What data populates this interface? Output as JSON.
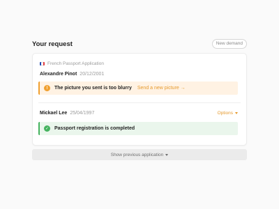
{
  "header": {
    "title": "Your request",
    "new_demand_label": "New demand"
  },
  "application": {
    "label": "French Passport Application",
    "flag_icon": "france-flag-icon",
    "flag_colors": [
      "#1f49b3",
      "#ffffff",
      "#e03a3e"
    ]
  },
  "requests": [
    {
      "name": "Alexandre Pinot",
      "date": "20/12/2001",
      "alert": {
        "status": "warning",
        "icon": "exclamation-circle-icon",
        "icon_glyph": "!",
        "message": "The picture you sent is too blurry",
        "action_label": "Send a new picture →"
      }
    },
    {
      "name": "Mickael Lee",
      "date": "25/04/1997",
      "options_label": "Options",
      "alert": {
        "status": "success",
        "icon": "check-circle-icon",
        "icon_glyph": "✓",
        "message": "Passport registration is completed"
      }
    }
  ],
  "footer": {
    "show_previous_label": "Show previous application"
  },
  "colors": {
    "accent_orange": "#e69a2e",
    "warning_bg": "#fff2e3",
    "success_green": "#45b35f",
    "success_bg": "#eaf6ec"
  }
}
